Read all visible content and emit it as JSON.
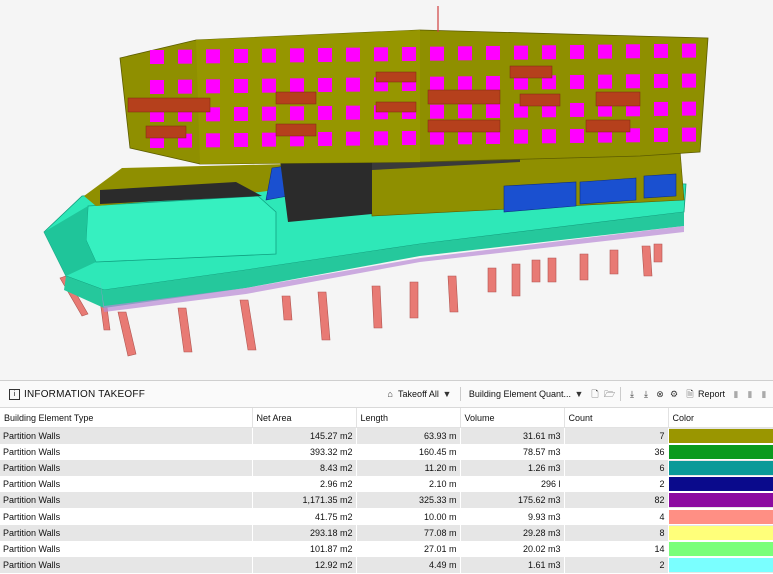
{
  "panel": {
    "title": "INFORMATION TAKEOFF",
    "title_icon": "i",
    "takeoff_label": "Takeoff All",
    "mode_label": "Building Element Quant...",
    "report_label": "Report"
  },
  "table": {
    "headers": [
      "Building Element Type",
      "Net Area",
      "Length",
      "Volume",
      "Count",
      "Color"
    ],
    "rows": [
      {
        "type": "Partition Walls",
        "area": "145.27 m2",
        "length": "63.93 m",
        "volume": "31.61 m3",
        "count": "7",
        "color": "#9a9600"
      },
      {
        "type": "Partition Walls",
        "area": "393.32 m2",
        "length": "160.45 m",
        "volume": "78.57 m3",
        "count": "36",
        "color": "#0a9a1e"
      },
      {
        "type": "Partition Walls",
        "area": "8.43 m2",
        "length": "11.20 m",
        "volume": "1.26 m3",
        "count": "6",
        "color": "#0a9a98"
      },
      {
        "type": "Partition Walls",
        "area": "2.96 m2",
        "length": "2.10 m",
        "volume": "296 l",
        "count": "2",
        "color": "#0a0a8c"
      },
      {
        "type": "Partition Walls",
        "area": "1,171.35 m2",
        "length": "325.33 m",
        "volume": "175.62 m3",
        "count": "82",
        "color": "#8c0aa0"
      },
      {
        "type": "Partition Walls",
        "area": "41.75 m2",
        "length": "10.00 m",
        "volume": "9.93 m3",
        "count": "4",
        "color": "#ff8f84"
      },
      {
        "type": "Partition Walls",
        "area": "293.18 m2",
        "length": "77.08 m",
        "volume": "29.28 m3",
        "count": "8",
        "color": "#ffff7a"
      },
      {
        "type": "Partition Walls",
        "area": "101.87 m2",
        "length": "27.01 m",
        "volume": "20.02 m3",
        "count": "14",
        "color": "#7aff7a"
      },
      {
        "type": "Partition Walls",
        "area": "12.92 m2",
        "length": "4.49 m",
        "volume": "1.61 m3",
        "count": "2",
        "color": "#7affff"
      }
    ]
  },
  "viewport": {
    "colors": {
      "olive": "#8f8f00",
      "magenta": "#ff00ff",
      "brown": "#b5401c",
      "teal": "#2ee8b8",
      "blue": "#1a50d0",
      "pile": "#e87a74",
      "dark": "#2b2b2b"
    }
  }
}
